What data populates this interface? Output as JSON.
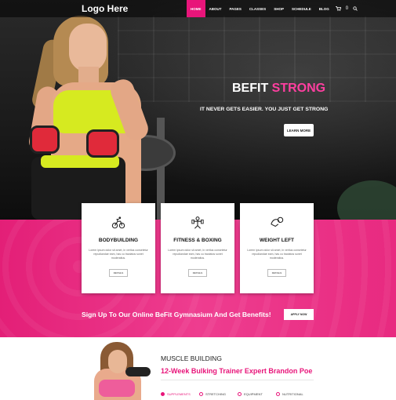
{
  "header": {
    "logo": "Logo Here",
    "nav": [
      {
        "label": "HOME",
        "active": true
      },
      {
        "label": "ABOUT"
      },
      {
        "label": "PAGES"
      },
      {
        "label": "CLASSES"
      },
      {
        "label": "SHOP"
      },
      {
        "label": "SCHEDULE"
      },
      {
        "label": "BLOG"
      }
    ],
    "cart_count": "0"
  },
  "hero": {
    "title_main": "BEFIT",
    "title_accent": "STRONG",
    "subtitle": "IT NEVER GETS EASIER. YOU JUST GET STRONG",
    "button": "LEARN MORE"
  },
  "cards": [
    {
      "icon": "bicycle-icon",
      "title": "BODYBUILDING",
      "text": "Lorem ipsum dolor sit amet, in veritus consetetur repudiandae eam, has cu tractatos sonet moderatius.",
      "button": "DETAILS"
    },
    {
      "icon": "boxing-icon",
      "title": "FITNESS & BOXING",
      "text": "Lorem ipsum dolor sit amet, in veritus consetetur repudiandae eam, has cu tractatos sonet moderatius.",
      "button": "DETAILS"
    },
    {
      "icon": "weight-icon",
      "title": "WEIGHT LEFT",
      "text": "Lorem ipsum dolor sit amet, in veritus consetetur repudiandae eam, has cu tractatos sonet moderatius.",
      "button": "DETAILS"
    }
  ],
  "signup": {
    "text": "Sign Up To Our Online BeFit Gymnasium And Get Benefits!",
    "button": "APPLY NOW"
  },
  "section": {
    "kicker": "MUSCLE BUILDING",
    "title": "12-Week Bulking Trainer Expert Brandon Poe",
    "tabs": [
      "SUPPLEMENTS",
      "STRETCHING",
      "EQUIPMENT",
      "NUTRITIONAL"
    ]
  },
  "colors": {
    "accent": "#e8157a",
    "hero_accent": "#ff3fa0"
  }
}
